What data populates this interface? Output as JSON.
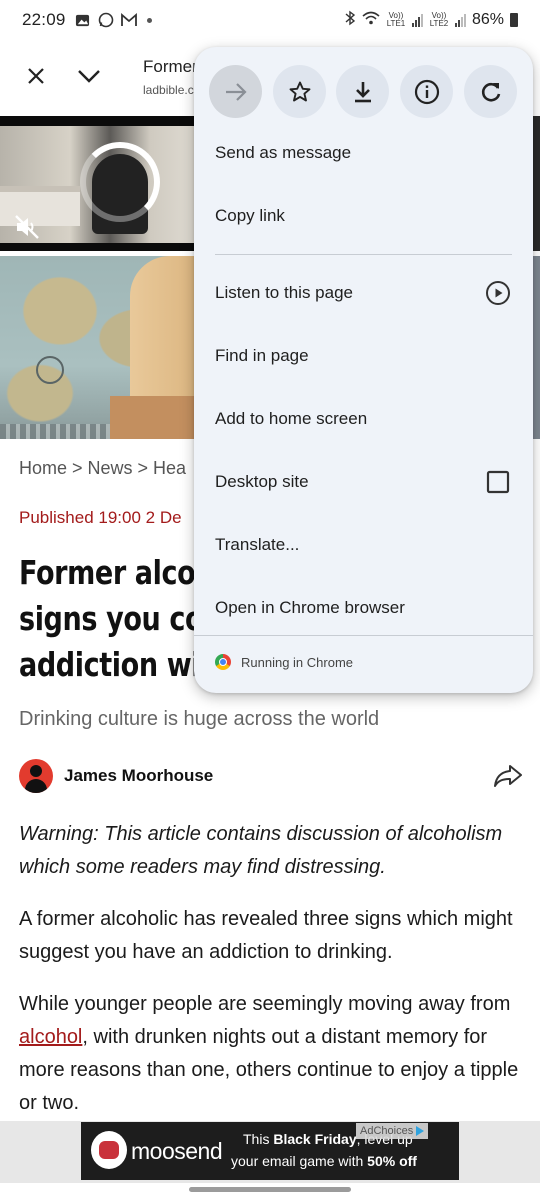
{
  "status_bar": {
    "time": "22:09",
    "sim1_label": "Vo)) LTE1",
    "sim2_label": "Vo)) LTE2",
    "battery": "86%"
  },
  "toolbar": {
    "title": "Former",
    "url": "ladbible.c"
  },
  "article": {
    "breadcrumb": "Home > News > Hea",
    "published": "Published 19:00 2 De",
    "headline_lines": [
      "Former alco",
      "signs you co",
      "addiction wi"
    ],
    "standfirst": "Drinking culture is huge across the world",
    "author": "James Moorhouse",
    "paragraphs": {
      "warning": "Warning: This article contains discussion of alcoholism which some readers may find distressing.",
      "p2": "A former alcoholic has revealed three signs which might suggest you have an addiction to drinking.",
      "p3_before": "While younger people are seemingly moving away from ",
      "p3_link": "alcohol",
      "p3_after": ", with drunken nights out a distant memory for more reasons than one, others continue to enjoy a tipple or two."
    }
  },
  "ad": {
    "brand": "moosend",
    "line1_pre": "This ",
    "line1_bold": "Black Friday",
    "line1_post": ", level up",
    "line2_pre": "your email game with ",
    "line2_bold": "50% off",
    "adchoices": "AdChoices"
  },
  "menu": {
    "top_icons": [
      "forward-icon",
      "bookmark-star-icon",
      "download-icon",
      "page-info-icon",
      "refresh-icon"
    ],
    "items": {
      "send_as_message": "Send as message",
      "copy_link": "Copy link",
      "listen": "Listen to this page",
      "find_in_page": "Find in page",
      "add_to_home": "Add to home screen",
      "desktop_site": "Desktop site",
      "translate": "Translate...",
      "open_in_chrome": "Open in Chrome browser"
    },
    "desktop_site_checked": false,
    "footer": "Running in Chrome"
  },
  "colors": {
    "menu_bg": "#eff3f9",
    "accent_red": "#a31b1b"
  }
}
